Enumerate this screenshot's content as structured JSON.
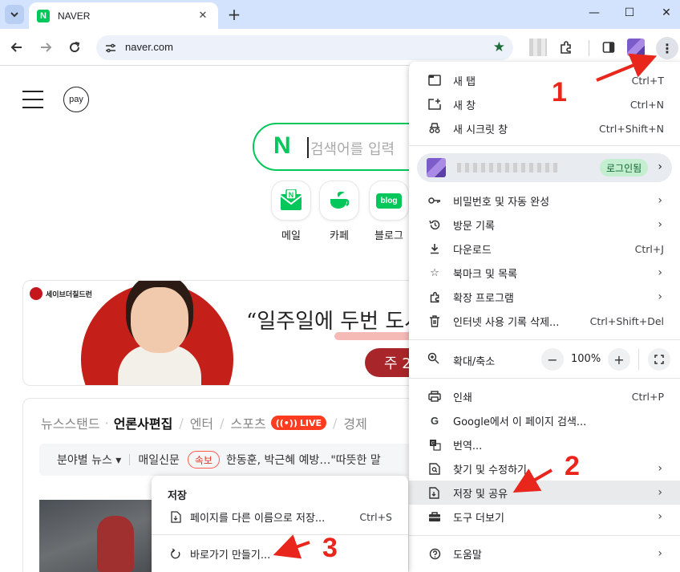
{
  "browser": {
    "tab_title": "NAVER",
    "favicon_letter": "N",
    "url": "naver.com",
    "window_controls": {
      "minimize": "—",
      "maximize": "☐",
      "close": "✕"
    }
  },
  "page": {
    "pay_label": "pay",
    "search_logo": "N",
    "search_placeholder": "검색어를 입력",
    "shortcuts": [
      {
        "label": "메일",
        "icon": "mail-icon"
      },
      {
        "label": "카페",
        "icon": "cafe-icon"
      },
      {
        "label": "블로그",
        "icon": "blog-icon",
        "badge": "blog"
      }
    ],
    "banner": {
      "org": "세이브더칠드런",
      "headline": "“일주일에 두번 도시",
      "button": "주 2"
    },
    "news": {
      "tabs": [
        "뉴스스탠드",
        "언론사편집",
        "엔터",
        "스포츠",
        "경제"
      ],
      "live": "LIVE",
      "filter": "분야별 뉴스 ▾",
      "source": "매일신문",
      "breaking": "속보",
      "headline": "한동훈, 박근혜 예방…\"따뜻한 말"
    }
  },
  "menu": {
    "new_tab": {
      "label": "새 탭",
      "shortcut": "Ctrl+T"
    },
    "new_window": {
      "label": "새 창",
      "shortcut": "Ctrl+N"
    },
    "incognito": {
      "label": "새 시크릿 창",
      "shortcut": "Ctrl+Shift+N"
    },
    "signed_in": "로그인됨",
    "passwords": "비밀번호 및 자동 완성",
    "history": "방문 기록",
    "downloads": {
      "label": "다운로드",
      "shortcut": "Ctrl+J"
    },
    "bookmarks": "북마크 및 목록",
    "extensions": "확장 프로그램",
    "clear_data": {
      "label": "인터넷 사용 기록 삭제...",
      "shortcut": "Ctrl+Shift+Del"
    },
    "zoom": {
      "label": "확대/축소",
      "minus": "−",
      "value": "100%",
      "plus": "+"
    },
    "print": {
      "label": "인쇄",
      "shortcut": "Ctrl+P"
    },
    "google_search": "Google에서 이 페이지 검색...",
    "translate": "번역...",
    "find_edit": "찾기 및 수정하기",
    "save_share": "저장 및 공유",
    "more_tools": "도구 더보기",
    "help": "도움말"
  },
  "submenu": {
    "title": "저장",
    "save_as": {
      "label": "페이지를 다른 이름으로 저장...",
      "shortcut": "Ctrl+S"
    },
    "create_shortcut": "바로가기 만들기..."
  },
  "annotations": [
    "1",
    "2",
    "3"
  ],
  "colors": {
    "naver_green": "#03c75a",
    "annotation_red": "#e8261c",
    "tabbar": "#d3e3fd"
  }
}
